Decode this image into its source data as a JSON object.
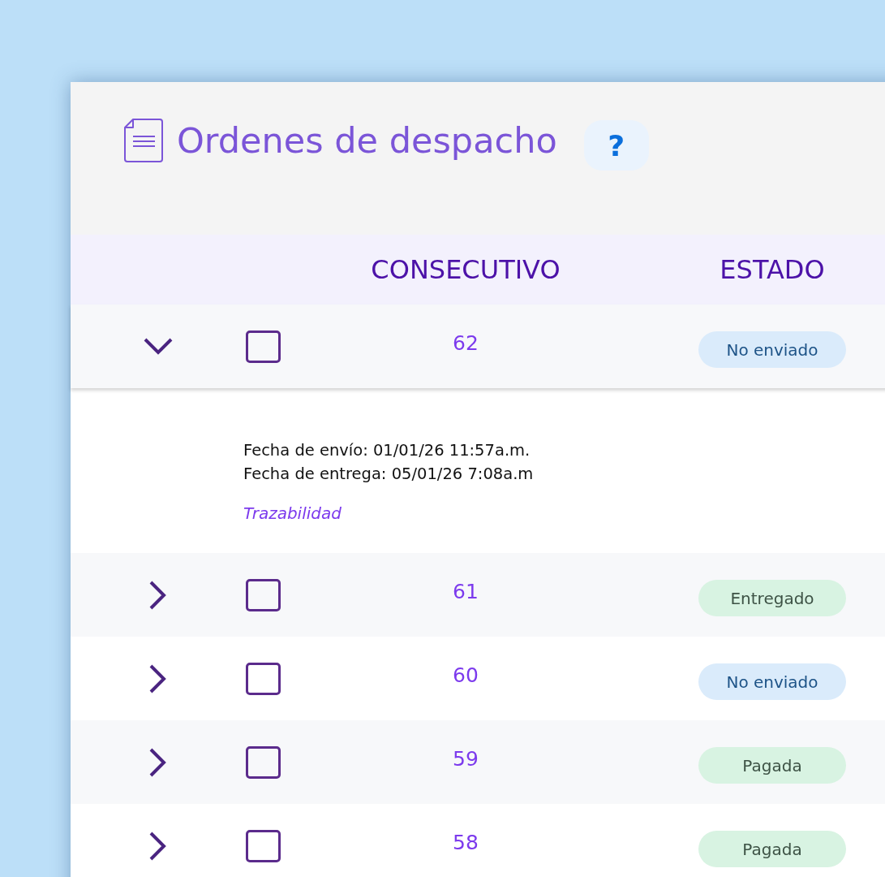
{
  "header": {
    "title": "Ordenes de despacho",
    "help_button": {
      "label": "?"
    }
  },
  "table": {
    "columns": [
      "CONSECUTIVO",
      "ESTADO"
    ],
    "rows": [
      {
        "expanded": true,
        "checked": false,
        "number": "62",
        "status": {
          "label": "No enviado",
          "color": "#daebfb"
        },
        "details": {
          "lines": [
            "Fecha de envío: 01/01/26 11:57a.m.",
            "Fecha de entrega: 05/01/26 7:08a.m"
          ],
          "link": "Trazabilidad"
        }
      },
      {
        "expanded": false,
        "checked": false,
        "number": "61",
        "status": {
          "label": "Entregado",
          "color": "#d8f3e2"
        }
      },
      {
        "expanded": false,
        "checked": false,
        "number": "60",
        "status": {
          "label": "No enviado",
          "color": "#daebfb"
        }
      },
      {
        "expanded": false,
        "checked": false,
        "number": "59",
        "status": {
          "label": "Pagada",
          "color": "#d8f3e2"
        }
      },
      {
        "expanded": false,
        "checked": false,
        "number": "58",
        "status": {
          "label": "Pagada",
          "color": "#d8f3e2"
        }
      }
    ]
  }
}
